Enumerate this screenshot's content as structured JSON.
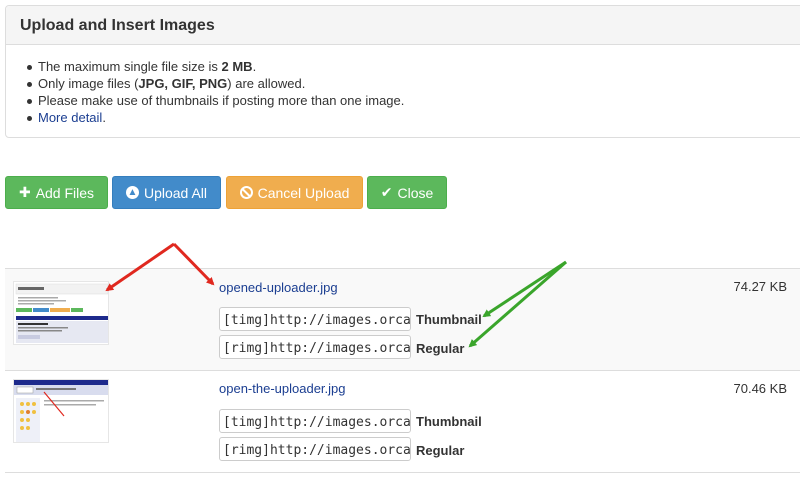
{
  "panel": {
    "title": "Upload and Insert Images",
    "rules": [
      {
        "pre": "The maximum single file size is ",
        "bold": "2 MB",
        "post": "."
      },
      {
        "pre": "Only image files (",
        "bold": "JPG, GIF, PNG",
        "post": ") are allowed."
      },
      {
        "pre": "Please make use of thumbnails if posting more than one image.",
        "bold": "",
        "post": ""
      }
    ],
    "more_link": "More detail",
    "more_post": "."
  },
  "toolbar": {
    "add_label": "Add Files",
    "upload_label": "Upload All",
    "cancel_label": "Cancel Upload",
    "close_label": "Close"
  },
  "icons": {
    "add": "plus-icon",
    "upload": "circle-arrow-up-icon",
    "cancel": "ban-icon",
    "close": "check-icon"
  },
  "colors": {
    "success": "#5cb85c",
    "primary": "#428bca",
    "warning": "#f0ad4e",
    "link": "#1b3e91",
    "annotation_red": "#e0281f",
    "annotation_green": "#3aa52b"
  },
  "files": [
    {
      "name": "opened-uploader.jpg",
      "size": "74.27 KB",
      "thumb_code": "[timg]http://images.orca-online",
      "regular_code": "[rimg]http://images.orca-online",
      "thumb_label": "Thumbnail",
      "regular_label": "Regular"
    },
    {
      "name": "open-the-uploader.jpg",
      "size": "70.46 KB",
      "thumb_code": "[timg]http://images.orca-online",
      "regular_code": "[rimg]http://images.orca-online",
      "thumb_label": "Thumbnail",
      "regular_label": "Regular"
    }
  ]
}
